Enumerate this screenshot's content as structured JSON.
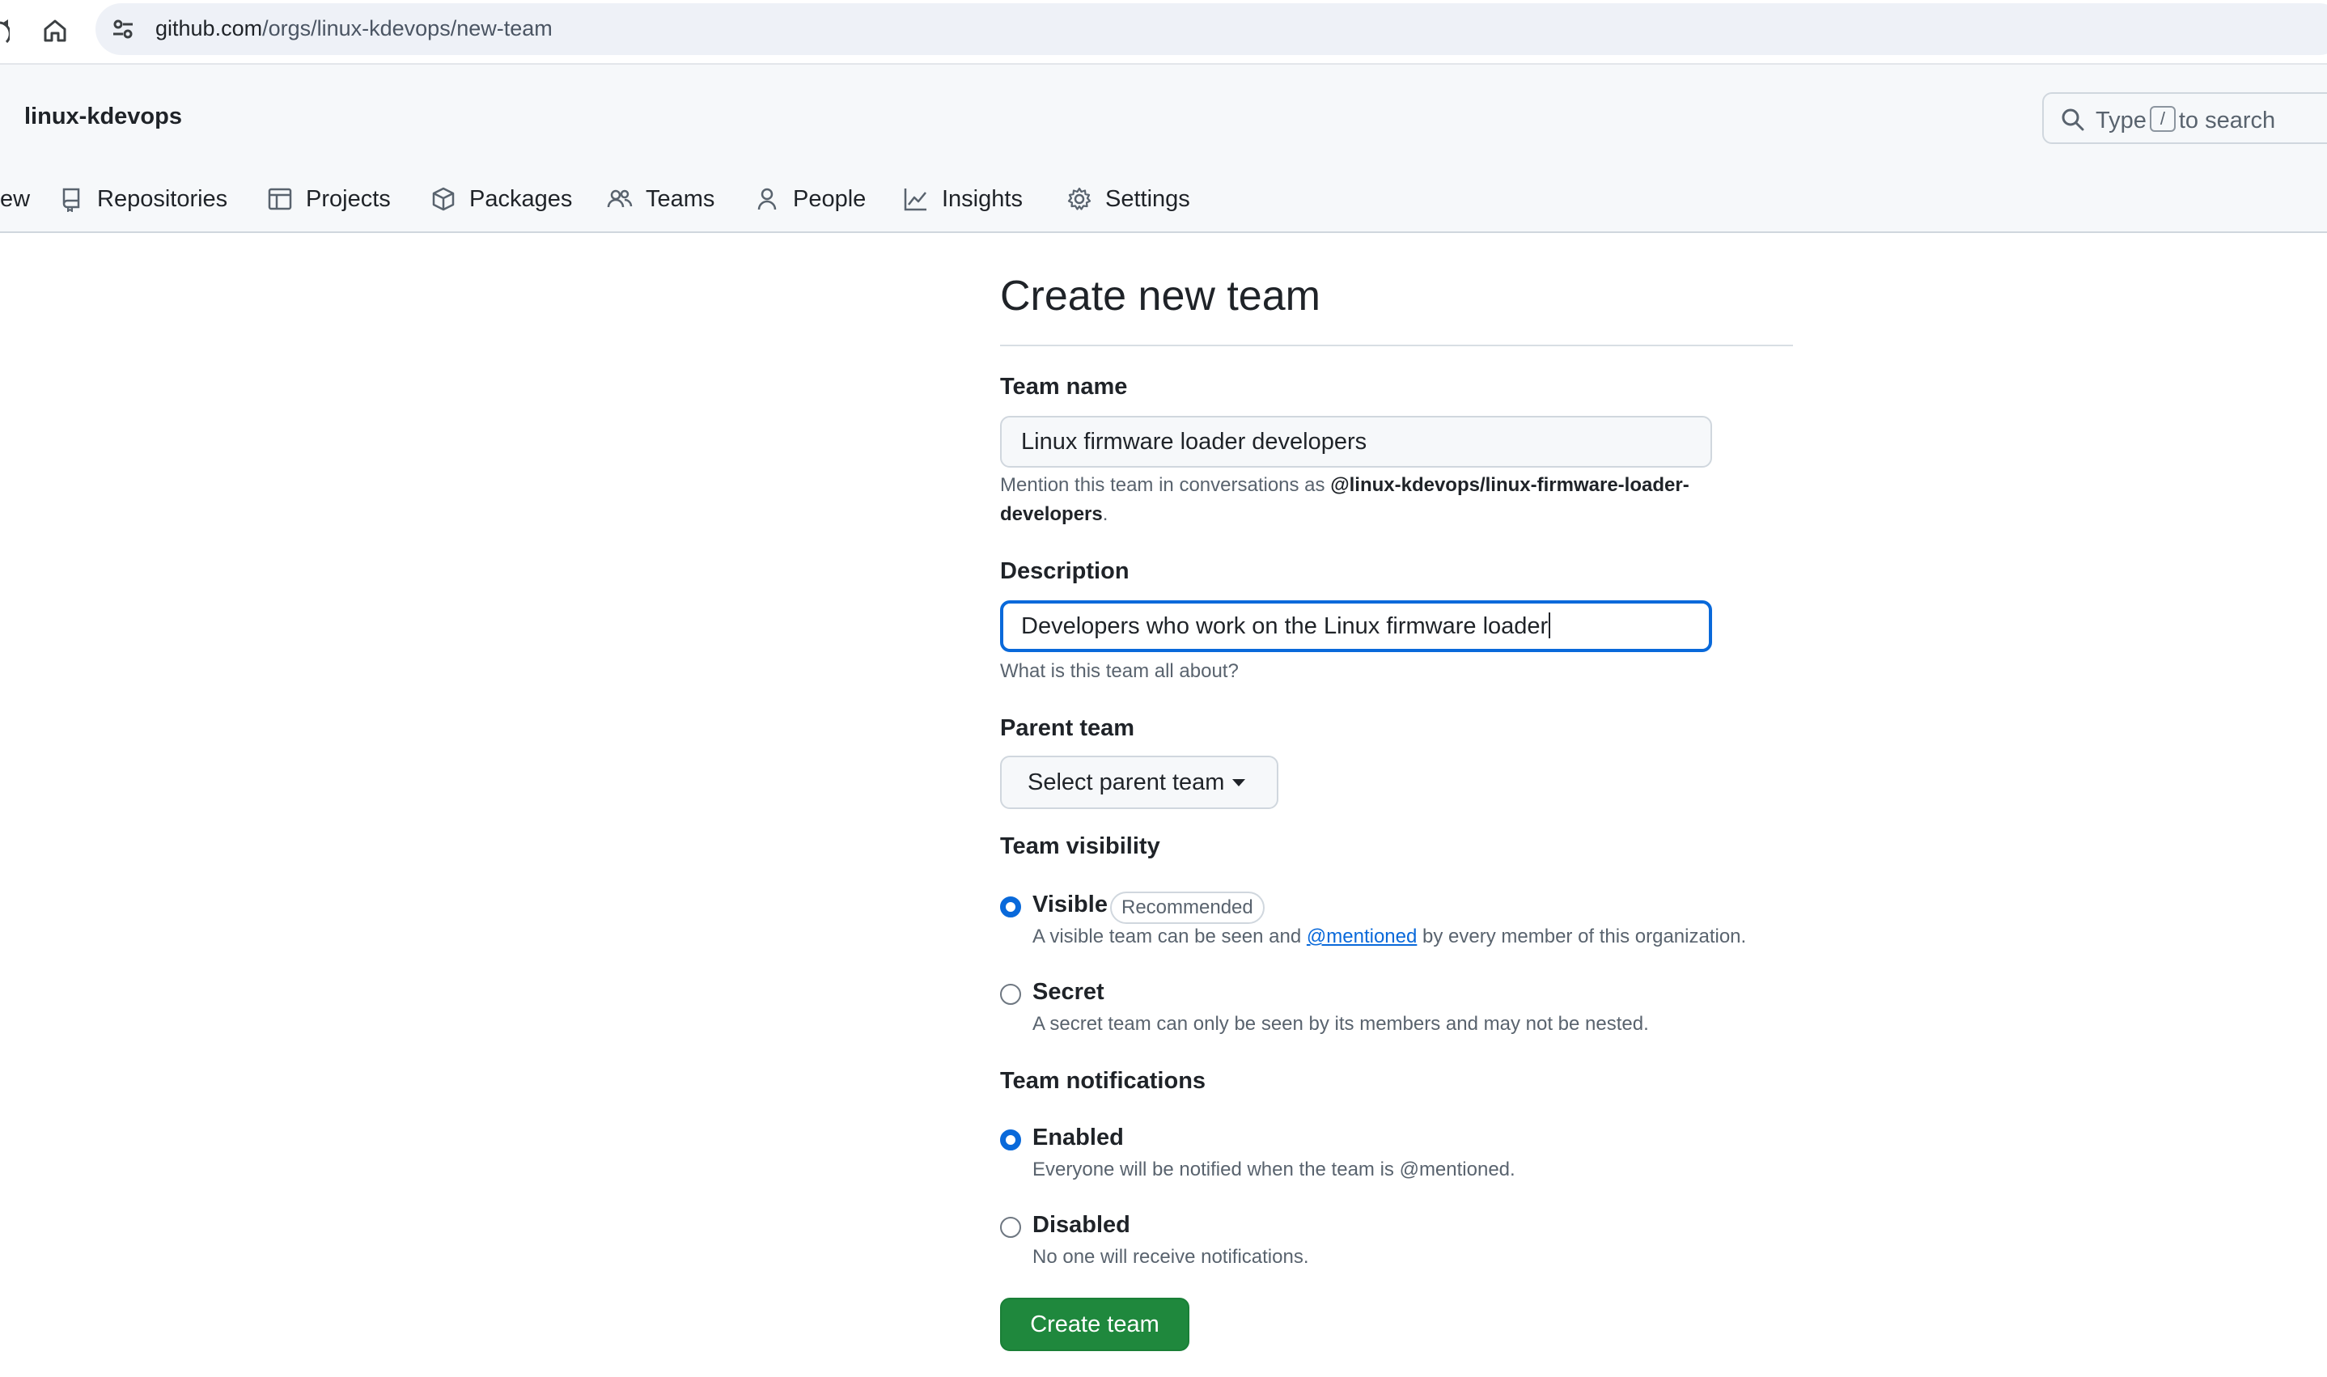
{
  "browser": {
    "url_domain": "github.com",
    "url_path": "/orgs/linux-kdevops/new-team"
  },
  "header": {
    "org_name": "linux-kdevops",
    "search_prefix": "Type",
    "search_key": "/",
    "search_suffix": "to search",
    "nav": [
      {
        "label": "ew",
        "icon": "overview-icon"
      },
      {
        "label": "Repositories",
        "icon": "repo-icon"
      },
      {
        "label": "Projects",
        "icon": "table-icon"
      },
      {
        "label": "Packages",
        "icon": "package-icon"
      },
      {
        "label": "Teams",
        "icon": "people-icon"
      },
      {
        "label": "People",
        "icon": "person-icon"
      },
      {
        "label": "Insights",
        "icon": "graph-icon"
      },
      {
        "label": "Settings",
        "icon": "gear-icon"
      }
    ]
  },
  "form": {
    "title": "Create new team",
    "team_name_label": "Team name",
    "team_name_value": "Linux firmware loader developers",
    "mention_hint_prefix": "Mention this team in conversations as ",
    "mention_handle": "@linux-kdevops/linux-firmware-loader-developers",
    "mention_hint_suffix": ".",
    "description_label": "Description",
    "description_value": "Developers who work on the Linux firmware loader",
    "description_hint": "What is this team all about?",
    "parent_team_label": "Parent team",
    "parent_team_button": "Select parent team",
    "visibility_label": "Team visibility",
    "visibility_options": [
      {
        "title": "Visible",
        "badge": "Recommended",
        "desc_prefix": "A visible team can be seen and ",
        "desc_link": "@mentioned",
        "desc_suffix": " by every member of this organization.",
        "checked": true
      },
      {
        "title": "Secret",
        "desc": "A secret team can only be seen by its members and may not be nested.",
        "checked": false
      }
    ],
    "notifications_label": "Team notifications",
    "notification_options": [
      {
        "title": "Enabled",
        "desc": "Everyone will be notified when the team is @mentioned.",
        "checked": true
      },
      {
        "title": "Disabled",
        "desc": "No one will receive notifications.",
        "checked": false
      }
    ],
    "submit_label": "Create team"
  },
  "colors": {
    "accent": "#0969da",
    "primary_button": "#1f883d",
    "header_bg": "#f6f8fa"
  }
}
